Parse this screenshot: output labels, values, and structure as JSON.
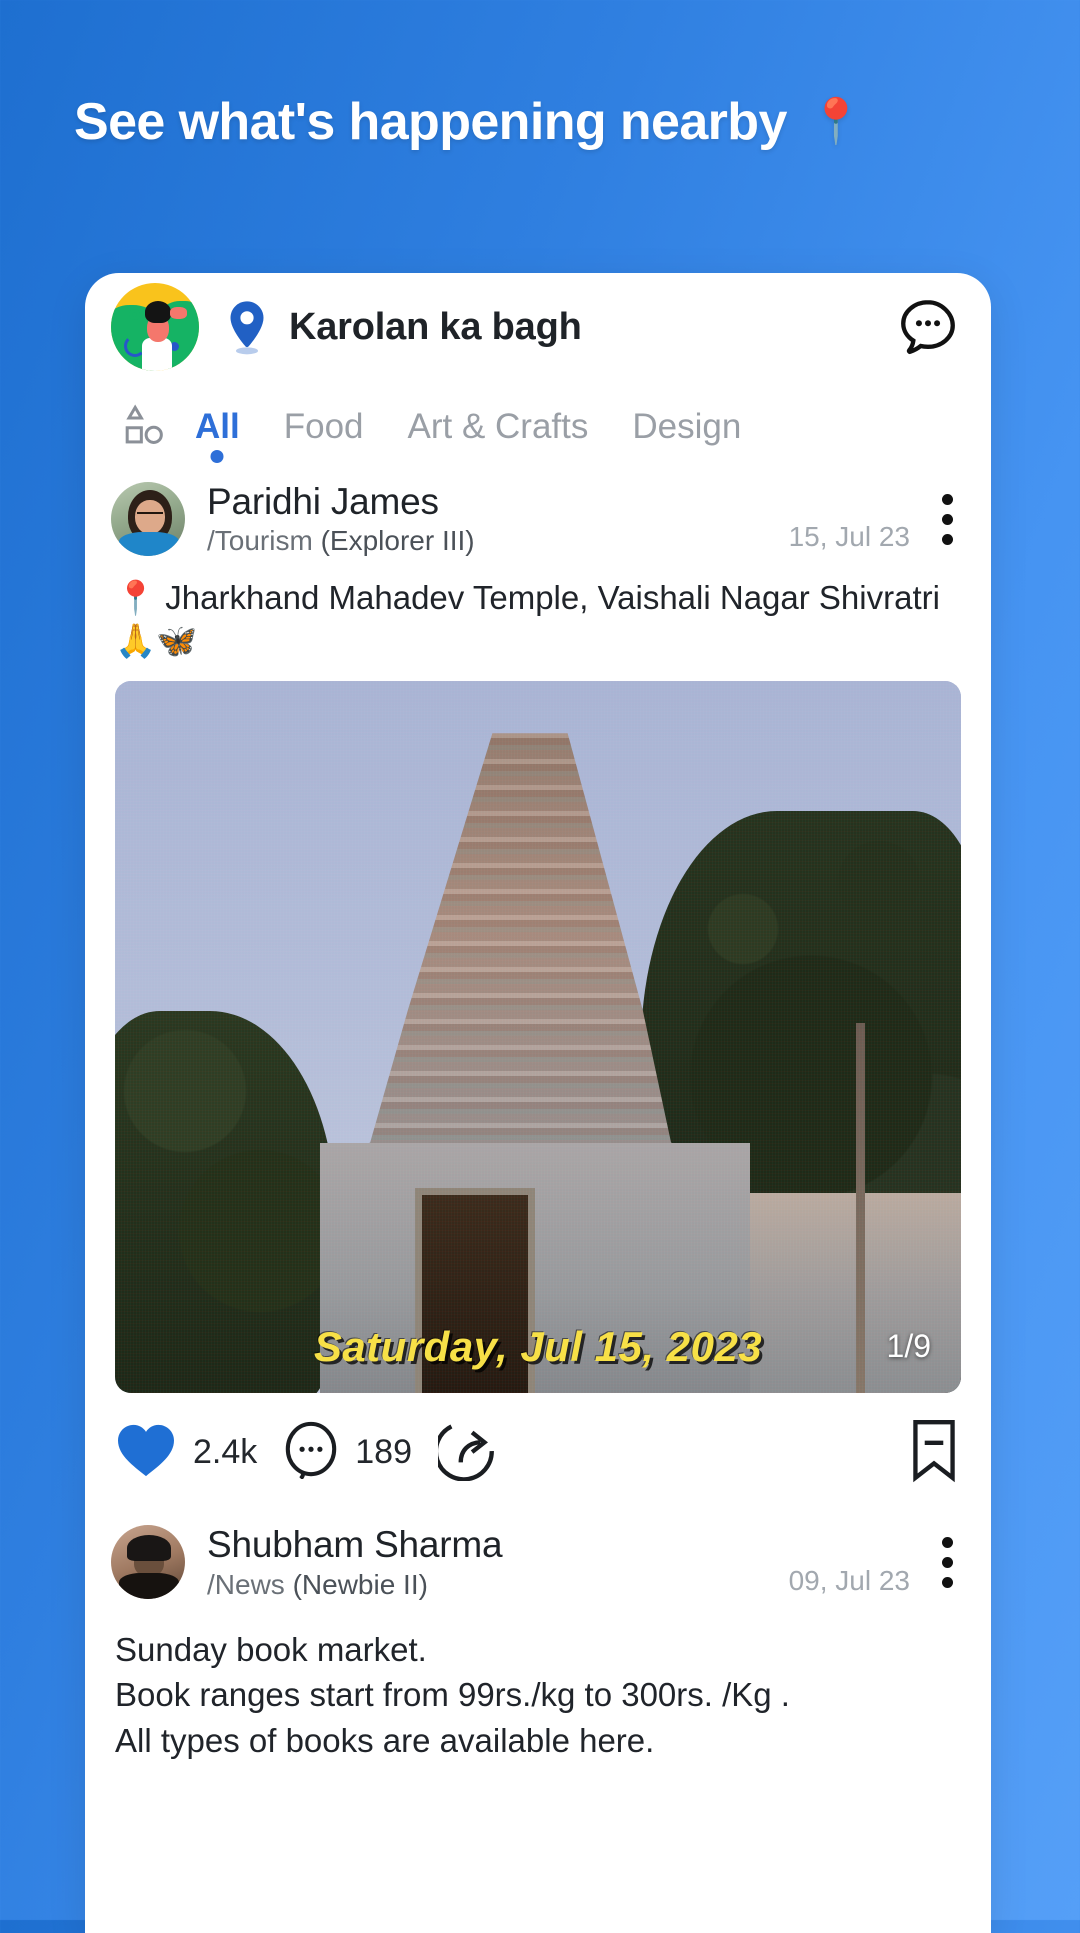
{
  "headline": {
    "text": "See what's happening nearby",
    "pin_icon": "round-pushpin-emoji"
  },
  "theme": {
    "bg_blue_dark": "#1e6fd0",
    "bg_blue_light": "#559ff7",
    "accent": "#2e6fd8",
    "like_blue": "#1f6fd4"
  },
  "card": {
    "location_header": {
      "avatar_icon": "illustrated-person-avatar",
      "pin_icon": "map-pin-icon",
      "title": "Karolan ka bagh",
      "chat_icon": "chat-bubble-dots-icon"
    },
    "tabs": {
      "shapes_icon": "shapes-filter-icon",
      "items": [
        {
          "label": "All",
          "active": true
        },
        {
          "label": "Food",
          "active": false
        },
        {
          "label": "Art & Crafts",
          "active": false
        },
        {
          "label": "Design",
          "active": false
        }
      ]
    },
    "posts": [
      {
        "avatar_icon": "user-photo-paridhi",
        "name": "Paridhi James",
        "handle": "/Tourism",
        "rank": "(Explorer III)",
        "date": "15, Jul 23",
        "menu_icon": "kebab-menu-icon",
        "caption": "📍 Jharkhand Mahadev Temple, Vaishali Nagar Shivratri 🙏🦋",
        "photo": {
          "alt": "hindu-temple-gopuram-photo",
          "date_stamp": "Saturday, Jul 15, 2023",
          "counter": "1/9"
        },
        "actions": {
          "like_icon": "heart-filled-icon",
          "like_count": "2.4k",
          "comment_icon": "comment-bubble-icon",
          "comment_count": "189",
          "share_icon": "share-arrow-icon",
          "save_icon": "bookmark-minus-icon"
        }
      },
      {
        "avatar_icon": "user-photo-shubham",
        "name": "Shubham Sharma",
        "handle": "/News",
        "rank": "(Newbie II)",
        "date": "09, Jul 23",
        "menu_icon": "kebab-menu-icon",
        "body_lines": [
          "Sunday book market.",
          "Book ranges start from 99rs./kg to 300rs. /Kg .",
          "All types of books are available here."
        ]
      }
    ]
  }
}
